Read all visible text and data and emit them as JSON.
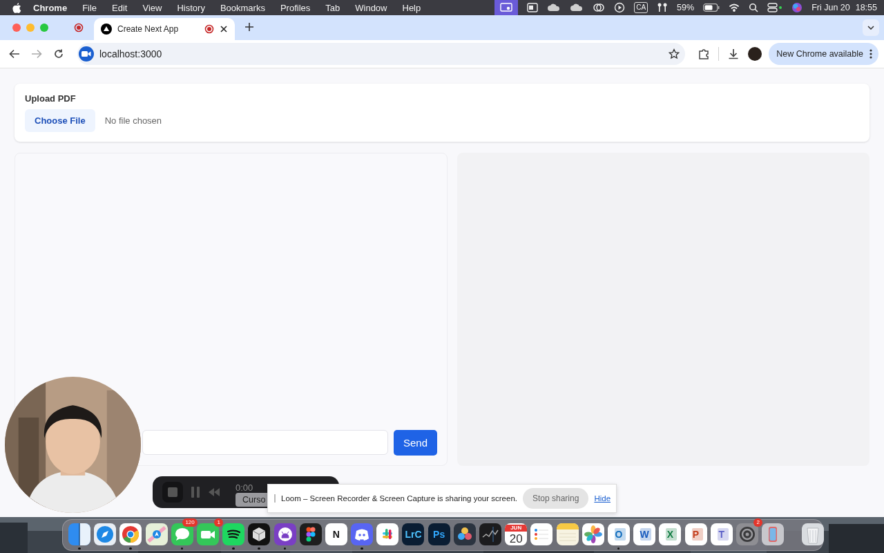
{
  "menu_bar": {
    "app": "Chrome",
    "menus": [
      "File",
      "Edit",
      "View",
      "History",
      "Bookmarks",
      "Profiles",
      "Tab",
      "Window",
      "Help"
    ],
    "caption_badge": "CA",
    "battery": "59%",
    "date": "Fri Jun 20",
    "time": "18:55"
  },
  "tabs": [
    {
      "kind": "pinned",
      "selected": false
    },
    {
      "kind": "page",
      "title": "Create Next App",
      "selected": true
    }
  ],
  "toolbar": {
    "address": "localhost:3000",
    "update_button": "New Chrome available"
  },
  "upload": {
    "label": "Upload PDF",
    "button": "Choose File",
    "status": "No file chosen"
  },
  "chat": {
    "send_button": "Send"
  },
  "loom_controls": {
    "time": "0:00",
    "tooltip": "Curso"
  },
  "share_bar": {
    "message": "Loom – Screen Recorder & Screen Capture is sharing your screen.",
    "stop_button": "Stop sharing",
    "hide_link": "Hide"
  },
  "dock": [
    {
      "kind": "finder",
      "running": true
    },
    {
      "kind": "safari",
      "running": false
    },
    {
      "kind": "chrome",
      "running": true
    },
    {
      "kind": "maps",
      "running": false
    },
    {
      "kind": "messages",
      "badge": "120",
      "running": true
    },
    {
      "kind": "facetime",
      "badge": "1",
      "running": false
    },
    {
      "kind": "spotify",
      "running": true
    },
    {
      "kind": "cursor",
      "running": true
    },
    {
      "kind": "github",
      "running": true
    },
    {
      "kind": "figma",
      "running": false
    },
    {
      "kind": "notion",
      "glyph": "N",
      "running": false
    },
    {
      "kind": "discord",
      "running": true
    },
    {
      "kind": "slack",
      "running": false
    },
    {
      "kind": "lightroom",
      "glyph": "LrC",
      "running": false
    },
    {
      "kind": "photoshop",
      "glyph": "Ps",
      "running": false
    },
    {
      "kind": "davinci",
      "running": false
    },
    {
      "kind": "stocks",
      "running": false
    },
    {
      "kind": "calendar",
      "month": "JUN",
      "glyph": "20",
      "running": false
    },
    {
      "kind": "reminders",
      "running": false
    },
    {
      "kind": "notes",
      "running": false
    },
    {
      "kind": "photos",
      "running": false
    },
    {
      "kind": "outlook",
      "glyph": "O",
      "running": true
    },
    {
      "kind": "word",
      "glyph": "W",
      "running": false
    },
    {
      "kind": "excel",
      "glyph": "X",
      "running": false
    },
    {
      "kind": "powerpoint",
      "glyph": "P",
      "running": false
    },
    {
      "kind": "teams",
      "glyph": "T",
      "running": false
    },
    {
      "kind": "settings",
      "badge": "2",
      "running": false
    },
    {
      "kind": "mirroring",
      "running": false
    },
    {
      "kind": "separator"
    },
    {
      "kind": "trash",
      "running": false
    }
  ]
}
